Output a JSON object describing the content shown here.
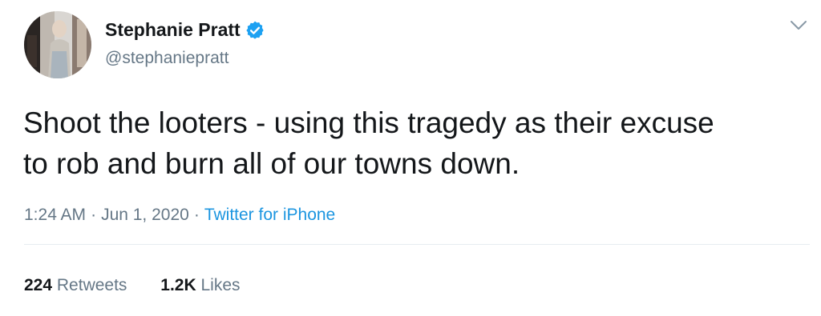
{
  "tweet": {
    "author": {
      "display_name": "Stephanie Pratt",
      "handle": "@stephaniepratt",
      "verified": true,
      "avatar_icon": "profile-photo"
    },
    "text_line1": "Shoot the looters - using this tragedy as their excuse",
    "text_line2": "to rob and burn all of our towns down.",
    "time": "1:24 AM",
    "date": "Jun 1, 2020",
    "separator": "·",
    "source": "Twitter for iPhone",
    "stats": {
      "retweets_count": "224",
      "retweets_label": "Retweets",
      "likes_count": "1.2K",
      "likes_label": "Likes"
    },
    "menu_icon": "chevron-down-icon"
  },
  "colors": {
    "text": "#14171a",
    "secondary": "#657786",
    "link": "#1b95e0",
    "verified": "#1da1f2",
    "divider": "#e6ecf0"
  }
}
